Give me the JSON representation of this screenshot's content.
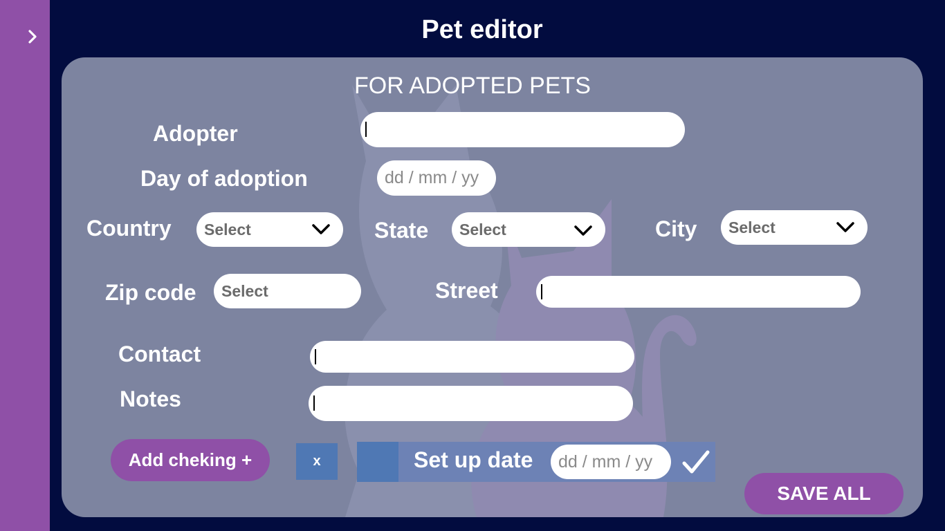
{
  "sidebar": {
    "toggle_icon": "chevron-right-icon"
  },
  "header": {
    "title": "Pet editor"
  },
  "form": {
    "section_title": "FOR ADOPTED PETS",
    "adopter": {
      "label": "Adopter",
      "value": ""
    },
    "day_of_adoption": {
      "label": "Day of adoption",
      "placeholder": "dd / mm / yy"
    },
    "country": {
      "label": "Country",
      "value": "Select"
    },
    "state": {
      "label": "State",
      "value": "Select"
    },
    "city": {
      "label": "City",
      "value": "Select"
    },
    "zip_code": {
      "label": "Zip code",
      "value": "Select"
    },
    "street": {
      "label": "Street",
      "value": ""
    },
    "contact": {
      "label": "Contact",
      "value": ""
    },
    "notes": {
      "label": "Notes",
      "value": ""
    }
  },
  "checking": {
    "add_button_label": "Add cheking +",
    "remove_button_label": "x",
    "setup_label": "Set up date",
    "setup_date_placeholder": "dd / mm / yy"
  },
  "actions": {
    "save_all_label": "SAVE ALL"
  },
  "colors": {
    "background": "#020c3f",
    "sidebar": "#8f50a7",
    "card": "#7d84a0",
    "accent_purple": "#8f50a7",
    "accent_blue": "#4f78b4"
  }
}
